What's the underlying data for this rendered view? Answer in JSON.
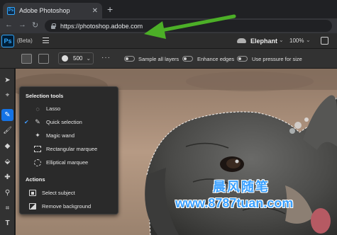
{
  "browser": {
    "tab_title": "Adobe Photoshop",
    "tab_favicon": "Ps",
    "url": "https://photoshop.adobe.com"
  },
  "app": {
    "logo": "Ps",
    "beta_label": "(Beta)",
    "document_name": "Elephant",
    "zoom_level": "100%"
  },
  "options": {
    "brush_size": "500",
    "sample_all_layers_label": "Sample all layers",
    "enhance_edges_label": "Enhance edges",
    "use_pressure_label": "Use pressure for size"
  },
  "flyout": {
    "heading": "Selection tools",
    "items": [
      {
        "label": "Lasso",
        "icon": "lasso-icon",
        "selected": false
      },
      {
        "label": "Quick selection",
        "icon": "quick-selection-icon",
        "selected": true
      },
      {
        "label": "Magic wand",
        "icon": "magic-wand-icon",
        "selected": false
      },
      {
        "label": "Rectangular marquee",
        "icon": "rect-marquee-icon",
        "selected": false
      },
      {
        "label": "Elliptical marquee",
        "icon": "ellipse-marquee-icon",
        "selected": false
      }
    ],
    "actions_heading": "Actions",
    "actions": [
      {
        "label": "Select subject",
        "icon": "select-subject-icon"
      },
      {
        "label": "Remove background",
        "icon": "remove-background-icon"
      }
    ]
  },
  "watermark": {
    "line1": "晨风随笔",
    "line2": "www.8787tuan.com"
  },
  "colors": {
    "accent": "#1473e6",
    "ps_blue": "#31a8ff",
    "annotation_arrow": "#4caf27"
  }
}
